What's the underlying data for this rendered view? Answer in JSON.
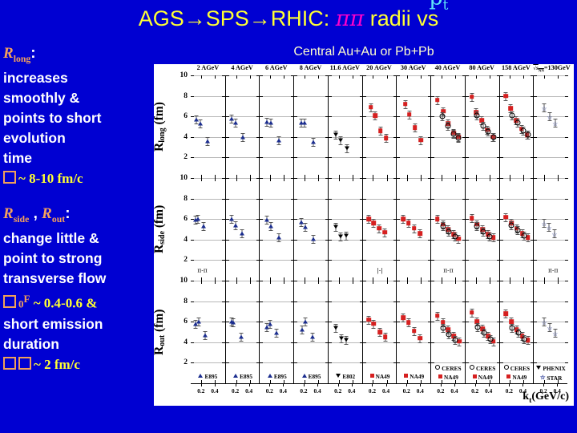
{
  "slide": {
    "title_parts": {
      "pre": "AGS→SPS→RHIC: ",
      "pipi": "ππ",
      "mid": " radii vs ",
      "pt": "p",
      "pt_sub": "t"
    },
    "subtitle": "Central Au+Au or Pb+Pb",
    "colors": {
      "background": "#0000d2",
      "title_yellow": "#ffff33",
      "pipi_magenta": "#ff00cc",
      "pt_cyan": "#5fe3f7",
      "header_orange": "#f4a15c",
      "body_white": "#ffffff",
      "bullet_yellow": "#ffff33",
      "subtitle_yellow": "#ffffcc",
      "marker_blue": "#1b2d8f",
      "marker_red": "#d62020"
    }
  },
  "left_panel": {
    "block1": {
      "header": "R",
      "header_sub": "long",
      "header_colon": ":",
      "lines": [
        "increases",
        "smoothly &",
        "points to short",
        "evolution",
        "time"
      ],
      "bullet": "~ 8-10 fm/c"
    },
    "block2": {
      "header_a": "R",
      "header_a_sub": "side",
      "comma": " , ",
      "header_b": "R",
      "header_b_sub": "out",
      "header_colon": ":",
      "lines": [
        "change little &",
        "point to strong",
        "transverse flow"
      ],
      "bullet_beta_sub": "0",
      "bullet_beta_sup": "F",
      "bullet1": "~ 0.4-0.6 &",
      "lines2": [
        "short emission",
        "duration"
      ],
      "bullet2": "~ 2 fm/c"
    }
  },
  "chart_data": {
    "type": "scatter",
    "title": "Central Au+Au or Pb+Pb",
    "xlabel": "k",
    "xlabel_sub": "t",
    "xlabel_unit": "(GeV/c)",
    "xlim": [
      0.05,
      0.55
    ],
    "xticks": [
      0.2,
      0.4
    ],
    "xticklabels": [
      "0.2",
      "0.4"
    ],
    "ylim": [
      0,
      10
    ],
    "yticks": [
      2,
      4,
      6,
      8,
      10
    ],
    "yticklabels": [
      "2",
      "4",
      "6",
      "8",
      "10"
    ],
    "grid": true,
    "legend_position": "bottom-inside-each-panel",
    "row_labels": [
      {
        "text": "R",
        "sub": "long",
        "unit": " (fm)"
      },
      {
        "text": "R",
        "sub": "side",
        "unit": " (fm)"
      },
      {
        "text": "R",
        "sub": "out",
        "unit": " (fm)"
      }
    ],
    "columns": [
      {
        "header": "2 AGeV",
        "legend": [
          "E895"
        ],
        "legend_syms": [
          "tri-up"
        ]
      },
      {
        "header": "4 AGeV",
        "legend": [
          "E895"
        ],
        "legend_syms": [
          "tri-up"
        ]
      },
      {
        "header": "6 AGeV",
        "legend": [
          "E895"
        ],
        "legend_syms": [
          "tri-up"
        ]
      },
      {
        "header": "8 AGeV",
        "legend": [
          "E895"
        ],
        "legend_syms": [
          "tri-up"
        ]
      },
      {
        "header": "11.6 AGeV",
        "legend": [
          "E802"
        ],
        "legend_syms": [
          "tri-dn"
        ]
      },
      {
        "header": "20 AGeV",
        "legend": [
          "NA49"
        ],
        "legend_syms": [
          "sqr"
        ]
      },
      {
        "header": "30 AGeV",
        "legend": [
          "NA49"
        ],
        "legend_syms": [
          "sqr"
        ]
      },
      {
        "header": "40 AGeV",
        "legend": [
          "CERES",
          "NA49"
        ],
        "legend_syms": [
          "circ",
          "sqr"
        ]
      },
      {
        "header": "80 AGeV",
        "legend": [
          "CERES",
          "NA49"
        ],
        "legend_syms": [
          "circ",
          "sqr"
        ]
      },
      {
        "header": "158 AGeV",
        "legend": [
          "CERES",
          "NA49"
        ],
        "legend_syms": [
          "circ",
          "sqr"
        ]
      },
      {
        "header": "√s_NN=130GeV",
        "legend": [
          "PHENIX",
          "STAR"
        ],
        "legend_syms": [
          "tri-dn-b",
          "star"
        ]
      }
    ],
    "annotations": [
      {
        "row": 1,
        "col": 0,
        "text": "π-π",
        "x": 0.22,
        "y": 1.0
      },
      {
        "row": 1,
        "col": 5,
        "text": "|-|",
        "x": 0.3,
        "y": 1.0
      },
      {
        "row": 1,
        "col": 7,
        "text": "π-π",
        "x": 0.3,
        "y": 1.0
      },
      {
        "row": 1,
        "col": 10,
        "text": "π-π",
        "x": 0.33,
        "y": 1.0
      }
    ],
    "series": [
      {
        "row": 0,
        "col": 0,
        "marker": "tri-up",
        "x": [
          0.13,
          0.19,
          0.3
        ],
        "y": [
          5.7,
          5.3,
          3.6
        ]
      },
      {
        "row": 0,
        "col": 1,
        "marker": "tri-up",
        "x": [
          0.13,
          0.19,
          0.3
        ],
        "y": [
          5.8,
          5.4,
          4.0
        ]
      },
      {
        "row": 0,
        "col": 2,
        "marker": "tri-up",
        "x": [
          0.15,
          0.21,
          0.32
        ],
        "y": [
          5.5,
          5.4,
          3.7
        ]
      },
      {
        "row": 0,
        "col": 3,
        "marker": "tri-up",
        "x": [
          0.15,
          0.2,
          0.33
        ],
        "y": [
          5.4,
          5.4,
          3.5
        ]
      },
      {
        "row": 0,
        "col": 4,
        "marker": "tri-dn",
        "x": [
          0.16,
          0.23,
          0.32
        ],
        "y": [
          4.2,
          3.7,
          2.9
        ]
      },
      {
        "row": 0,
        "col": 5,
        "marker": "sqr",
        "x": [
          0.17,
          0.23,
          0.31,
          0.39
        ],
        "y": [
          6.9,
          6.1,
          4.6,
          3.9
        ]
      },
      {
        "row": 0,
        "col": 6,
        "marker": "sqr",
        "x": [
          0.17,
          0.23,
          0.31,
          0.4
        ],
        "y": [
          7.2,
          6.2,
          4.9,
          3.7
        ]
      },
      {
        "row": 0,
        "col": 7,
        "marker": "sqr",
        "x": [
          0.14,
          0.23,
          0.3,
          0.38,
          0.45
        ],
        "y": [
          7.6,
          6.5,
          5.3,
          4.4,
          4.0
        ]
      },
      {
        "row": 0,
        "col": 8,
        "marker": "sqr",
        "x": [
          0.14,
          0.21,
          0.29,
          0.37,
          0.45
        ],
        "y": [
          7.9,
          6.4,
          5.6,
          4.7,
          4.0
        ]
      },
      {
        "row": 0,
        "col": 9,
        "marker": "sqr",
        "x": [
          0.14,
          0.21,
          0.29,
          0.37,
          0.45
        ],
        "y": [
          8.0,
          6.8,
          5.6,
          4.8,
          4.2
        ]
      },
      {
        "row": 0,
        "col": 10,
        "marker": "star",
        "x": [
          0.2,
          0.28,
          0.36
        ],
        "y": [
          6.9,
          6.0,
          5.4
        ]
      },
      {
        "row": 0,
        "col": 7,
        "marker": "circ",
        "x": [
          0.21,
          0.3,
          0.38,
          0.45
        ],
        "y": [
          6.0,
          5.1,
          4.3,
          3.9
        ]
      },
      {
        "row": 0,
        "col": 8,
        "marker": "circ",
        "x": [
          0.22,
          0.31,
          0.38,
          0.46
        ],
        "y": [
          6.1,
          5.1,
          4.5,
          4.0
        ]
      },
      {
        "row": 0,
        "col": 9,
        "marker": "circ",
        "x": [
          0.23,
          0.31,
          0.4,
          0.47
        ],
        "y": [
          6.1,
          5.4,
          4.6,
          4.2
        ]
      },
      {
        "row": 1,
        "col": 0,
        "marker": "tri-up",
        "x": [
          0.12,
          0.16,
          0.24
        ],
        "y": [
          5.9,
          6.0,
          5.3
        ]
      },
      {
        "row": 1,
        "col": 1,
        "marker": "tri-up",
        "x": [
          0.13,
          0.19,
          0.29
        ],
        "y": [
          6.0,
          5.4,
          4.6
        ]
      },
      {
        "row": 1,
        "col": 2,
        "marker": "tri-up",
        "x": [
          0.15,
          0.21,
          0.32
        ],
        "y": [
          5.9,
          5.3,
          4.2
        ]
      },
      {
        "row": 1,
        "col": 3,
        "marker": "tri-up",
        "x": [
          0.15,
          0.21,
          0.33
        ],
        "y": [
          5.7,
          5.2,
          4.1
        ]
      },
      {
        "row": 1,
        "col": 4,
        "marker": "tri-dn",
        "x": [
          0.16,
          0.23,
          0.31
        ],
        "y": [
          5.2,
          4.3,
          4.4
        ]
      },
      {
        "row": 1,
        "col": 5,
        "marker": "sqr",
        "x": [
          0.14,
          0.21,
          0.29,
          0.37
        ],
        "y": [
          6.0,
          5.6,
          5.1,
          4.7
        ]
      },
      {
        "row": 1,
        "col": 6,
        "marker": "sqr",
        "x": [
          0.14,
          0.22,
          0.3,
          0.39
        ],
        "y": [
          6.0,
          5.6,
          5.1,
          4.6
        ]
      },
      {
        "row": 1,
        "col": 7,
        "marker": "sqr",
        "x": [
          0.14,
          0.22,
          0.3,
          0.38,
          0.45
        ],
        "y": [
          6.0,
          5.5,
          5.0,
          4.5,
          4.1
        ]
      },
      {
        "row": 1,
        "col": 8,
        "marker": "sqr",
        "x": [
          0.14,
          0.22,
          0.3,
          0.38,
          0.46
        ],
        "y": [
          6.1,
          5.5,
          5.0,
          4.5,
          4.2
        ]
      },
      {
        "row": 1,
        "col": 9,
        "marker": "sqr",
        "x": [
          0.14,
          0.22,
          0.3,
          0.38,
          0.46
        ],
        "y": [
          6.2,
          5.6,
          5.1,
          4.6,
          4.2
        ]
      },
      {
        "row": 1,
        "col": 10,
        "marker": "star",
        "x": [
          0.2,
          0.27,
          0.35
        ],
        "y": [
          5.6,
          5.2,
          4.6
        ]
      },
      {
        "row": 1,
        "col": 7,
        "marker": "circ",
        "x": [
          0.22,
          0.31,
          0.4
        ],
        "y": [
          5.3,
          4.8,
          4.3
        ]
      },
      {
        "row": 1,
        "col": 8,
        "marker": "circ",
        "x": [
          0.22,
          0.31,
          0.4
        ],
        "y": [
          5.3,
          4.8,
          4.3
        ]
      },
      {
        "row": 1,
        "col": 9,
        "marker": "circ",
        "x": [
          0.22,
          0.31,
          0.41
        ],
        "y": [
          5.4,
          4.9,
          4.4
        ]
      },
      {
        "row": 2,
        "col": 0,
        "marker": "tri-up",
        "x": [
          0.12,
          0.17,
          0.26
        ],
        "y": [
          5.8,
          6.0,
          4.7
        ]
      },
      {
        "row": 2,
        "col": 1,
        "marker": "tri-up",
        "x": [
          0.13,
          0.16,
          0.28
        ],
        "y": [
          6.0,
          5.9,
          4.5
        ]
      },
      {
        "row": 2,
        "col": 2,
        "marker": "tri-up",
        "x": [
          0.15,
          0.2,
          0.29
        ],
        "y": [
          5.5,
          5.8,
          4.9
        ]
      },
      {
        "row": 2,
        "col": 3,
        "marker": "tri-up",
        "x": [
          0.16,
          0.21,
          0.32
        ],
        "y": [
          5.2,
          6.0,
          4.5
        ]
      },
      {
        "row": 2,
        "col": 4,
        "marker": "tri-dn",
        "x": [
          0.16,
          0.24,
          0.31
        ],
        "y": [
          5.4,
          4.4,
          4.2
        ]
      },
      {
        "row": 2,
        "col": 5,
        "marker": "sqr",
        "x": [
          0.14,
          0.21,
          0.3,
          0.38
        ],
        "y": [
          6.2,
          5.8,
          5.0,
          4.5
        ]
      },
      {
        "row": 2,
        "col": 6,
        "marker": "sqr",
        "x": [
          0.14,
          0.22,
          0.3,
          0.39
        ],
        "y": [
          6.4,
          5.9,
          5.1,
          4.4
        ]
      },
      {
        "row": 2,
        "col": 7,
        "marker": "sqr",
        "x": [
          0.14,
          0.22,
          0.3,
          0.38,
          0.46
        ],
        "y": [
          6.6,
          5.9,
          5.2,
          4.6,
          4.1
        ]
      },
      {
        "row": 2,
        "col": 8,
        "marker": "sqr",
        "x": [
          0.14,
          0.22,
          0.3,
          0.38,
          0.46
        ],
        "y": [
          6.9,
          6.0,
          5.3,
          4.6,
          4.1
        ]
      },
      {
        "row": 2,
        "col": 9,
        "marker": "sqr",
        "x": [
          0.14,
          0.22,
          0.3,
          0.38,
          0.46
        ],
        "y": [
          6.8,
          6.0,
          5.2,
          4.6,
          4.2
        ]
      },
      {
        "row": 2,
        "col": 10,
        "marker": "star",
        "x": [
          0.2,
          0.28,
          0.36
        ],
        "y": [
          6.0,
          5.5,
          4.9
        ]
      },
      {
        "row": 2,
        "col": 7,
        "marker": "circ",
        "x": [
          0.23,
          0.31,
          0.4
        ],
        "y": [
          5.4,
          4.8,
          4.2
        ]
      },
      {
        "row": 2,
        "col": 8,
        "marker": "circ",
        "x": [
          0.23,
          0.32,
          0.41
        ],
        "y": [
          5.5,
          4.9,
          4.3
        ]
      },
      {
        "row": 2,
        "col": 9,
        "marker": "circ",
        "x": [
          0.23,
          0.32,
          0.41
        ],
        "y": [
          5.4,
          4.9,
          4.3
        ]
      }
    ]
  }
}
